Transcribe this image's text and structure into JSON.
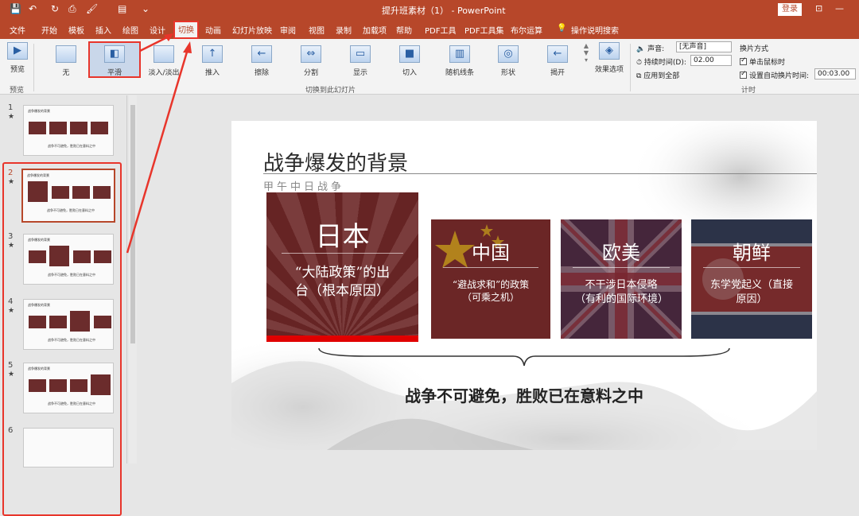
{
  "window": {
    "title": "提升班素材（1） - PowerPoint",
    "login": "登录",
    "minimize": "—",
    "restore": "▭",
    "ribbon_toggle": "⊡"
  },
  "quick_access": [
    "💾",
    "↶",
    "↻",
    "⎙",
    "🖌",
    "▤",
    "⌄"
  ],
  "tabs": [
    "文件",
    "开始",
    "模板",
    "插入",
    "绘图",
    "设计",
    "切换",
    "动画",
    "幻灯片放映",
    "审阅",
    "视图",
    "录制",
    "加载项",
    "帮助",
    "PDF工具",
    "PDF工具集",
    "布尔运算",
    "操作说明搜索"
  ],
  "ribbon": {
    "preview_label": "预览",
    "preview_group": "预览",
    "transitions": [
      "无",
      "平滑",
      "淡入/淡出",
      "推入",
      "擦除",
      "分割",
      "显示",
      "切入",
      "随机线条",
      "形状",
      "揭开"
    ],
    "effect_options": "效果选项",
    "transitions_group": "切换到此幻灯片",
    "sound_label": "声音:",
    "sound_value": "[无声音]",
    "duration_label": "持续时间(D):",
    "duration_value": "02.00",
    "apply_all": "应用到全部",
    "advance_label": "换片方式",
    "on_click": "单击鼠标时",
    "after_label": "设置自动换片时间:",
    "after_value": "00:03.00",
    "timing_group": "计时"
  },
  "thumbnails": [
    {
      "num": "1",
      "star": "★",
      "title": "战争爆发的背景",
      "footer": "战争不可避免，胜败已在意料之中"
    },
    {
      "num": "2",
      "star": "★",
      "title": "战争爆发的背景",
      "footer": "战争不可避免，胜败已在意料之中",
      "big": "日本"
    },
    {
      "num": "3",
      "star": "★",
      "title": "战争爆发的背景",
      "footer": "战争不可避免，胜败已在意料之中",
      "big": "中国"
    },
    {
      "num": "4",
      "star": "★",
      "title": "战争爆发的背景",
      "footer": "战争不可避免，胜败已在意料之中",
      "big": "欧美"
    },
    {
      "num": "5",
      "star": "★",
      "title": "战争爆发的背景",
      "footer": "战争不可避免，胜败已在意料之中",
      "big": "朝鲜"
    },
    {
      "num": "6",
      "star": "",
      "title": "",
      "footer": ""
    }
  ],
  "slide": {
    "title": "战争爆发的背景",
    "subtitle": "甲午中日战争",
    "cards": [
      {
        "name": "日本",
        "desc": "“大陆政策”的出台（根本原因）"
      },
      {
        "name": "中国",
        "desc": "“避战求和”的政策（可乘之机）"
      },
      {
        "name": "欧美",
        "desc": "不干涉日本侵略（有利的国际环境）"
      },
      {
        "name": "朝鲜",
        "desc": "东学党起义（直接原因）"
      }
    ],
    "conclusion": "战争不可避免，胜败已在意料之中"
  },
  "colors": {
    "accent": "#b7472a",
    "highlight": "#e8352b",
    "card": "#6b2626"
  }
}
